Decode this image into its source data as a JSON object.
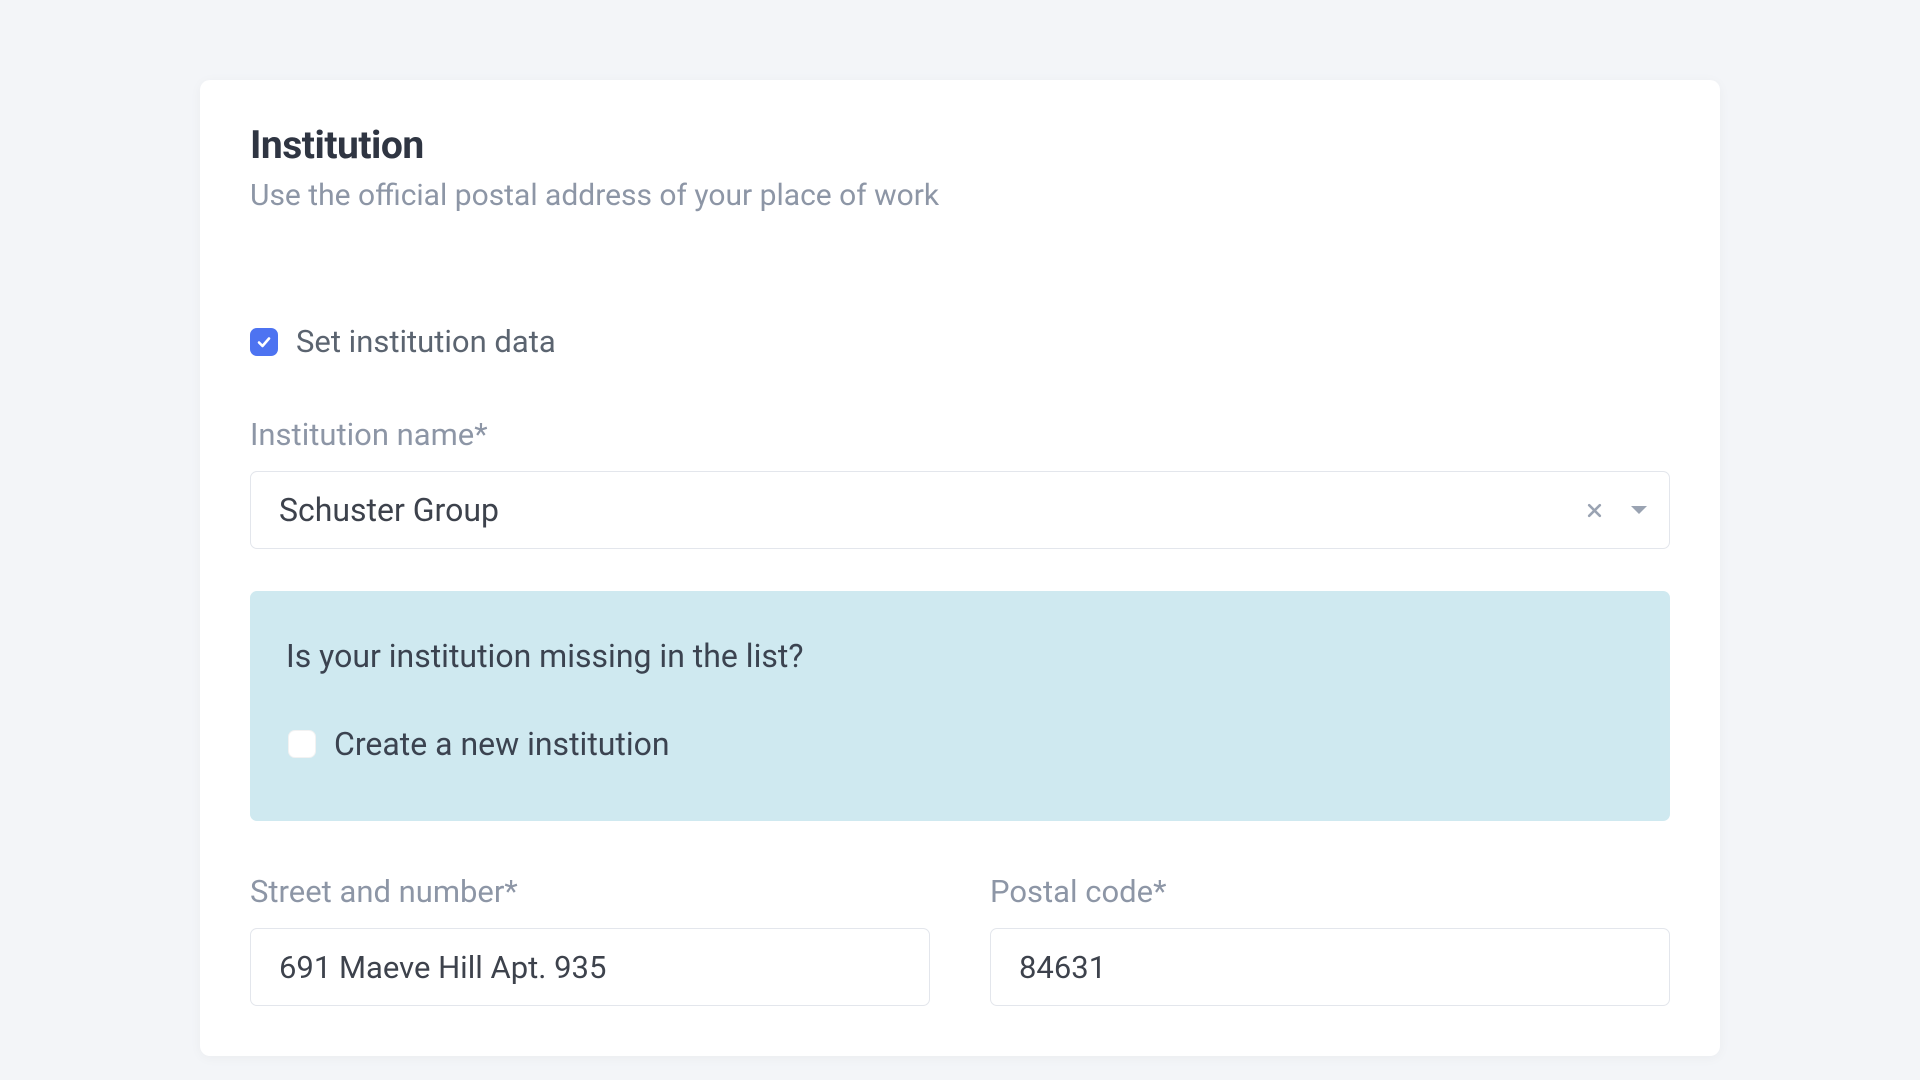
{
  "section": {
    "title": "Institution",
    "subtitle": "Use the official postal address of your place of work"
  },
  "setData": {
    "label": "Set institution data",
    "checked": true
  },
  "institutionName": {
    "label": "Institution name*",
    "value": "Schuster Group"
  },
  "missingPanel": {
    "title": "Is your institution missing in the list?",
    "createLabel": "Create a new institution",
    "createChecked": false
  },
  "street": {
    "label": "Street and number*",
    "value": "691 Maeve Hill Apt. 935"
  },
  "postal": {
    "label": "Postal code*",
    "value": "84631"
  }
}
